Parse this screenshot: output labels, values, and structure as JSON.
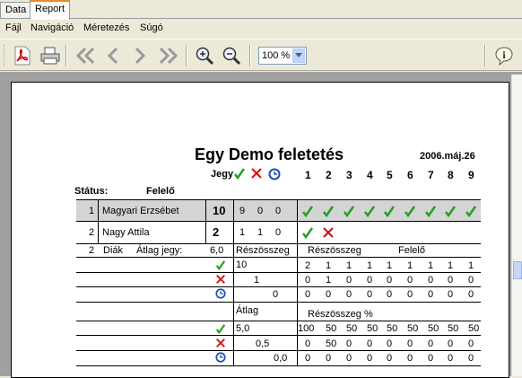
{
  "tabs": [
    "Data",
    "Report"
  ],
  "menu": [
    "Fájl",
    "Navigáció",
    "Méretezés",
    "Súgó"
  ],
  "zoom_value": "100 %",
  "toolbar_icons": [
    "pdf-icon",
    "print-icon",
    "first-page-icon",
    "prev-page-icon",
    "next-page-icon",
    "last-page-icon",
    "zoom-in-icon",
    "zoom-out-icon",
    "info-icon"
  ],
  "report": {
    "title": "Egy Demo feletetés",
    "date": "2006.máj.26",
    "jegy_label": "Jegy",
    "status_label": "Státus:",
    "status_value": "Felelő",
    "col_numbers": [
      "1",
      "2",
      "3",
      "4",
      "5",
      "6",
      "7",
      "8",
      "9"
    ],
    "students": [
      {
        "idx": "1",
        "name": "Magyari Erzsébet",
        "jegy": "10",
        "ok": "9",
        "bad": "0",
        "late": "0",
        "marks": [
          "ok",
          "ok",
          "ok",
          "ok",
          "ok",
          "ok",
          "ok",
          "ok",
          "ok"
        ]
      },
      {
        "idx": "2",
        "name": "Nagy Attila",
        "jegy": "2",
        "ok": "1",
        "bad": "1",
        "late": "0",
        "marks": [
          "ok",
          "bad",
          "",
          "",
          "",
          "",
          "",
          "",
          ""
        ]
      }
    ],
    "summary": {
      "diak_count": "2",
      "diak_label": "Diák",
      "atlag_jegy_label": "Átlag jegy:",
      "atlag_jegy_value": "6,0",
      "reszosszeg_label": "Részösszeg",
      "reszosszeg_label2": "Részösszeg",
      "felelo_label": "Felelő",
      "ok_total": "10",
      "bad_total": "1",
      "late_total": "0",
      "ok_row": [
        "2",
        "1",
        "1",
        "1",
        "1",
        "1",
        "1",
        "1",
        "1"
      ],
      "bad_row": [
        "0",
        "1",
        "0",
        "0",
        "0",
        "0",
        "0",
        "0",
        "0"
      ],
      "late_row": [
        "0",
        "0",
        "0",
        "0",
        "0",
        "0",
        "0",
        "0",
        "0"
      ],
      "atlag_label": "Átlag",
      "reszosszeg_pct_label": "Részösszeg  %",
      "ok_avg": "5,0",
      "bad_avg": "0,5",
      "late_avg": "0,0",
      "ok_pct": [
        "100",
        "50",
        "50",
        "50",
        "50",
        "50",
        "50",
        "50",
        "50"
      ],
      "bad_pct": [
        "0",
        "50",
        "0",
        "0",
        "0",
        "0",
        "0",
        "0",
        "0"
      ],
      "late_pct": [
        "0",
        "0",
        "0",
        "0",
        "0",
        "0",
        "0",
        "0",
        "0"
      ]
    }
  }
}
